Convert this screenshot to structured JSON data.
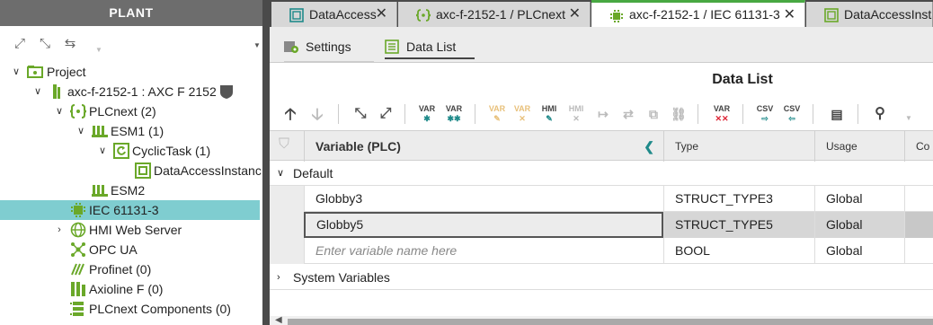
{
  "plant": {
    "title": "PLANT",
    "tree": [
      {
        "label": "Project"
      },
      {
        "label": "axc-f-2152-1 : AXC F 2152"
      },
      {
        "label": "PLCnext (2)"
      },
      {
        "label": "ESM1 (1)"
      },
      {
        "label": "CyclicTask (1)"
      },
      {
        "label": "DataAccessInstanc"
      },
      {
        "label": "ESM2"
      },
      {
        "label": "IEC 61131-3"
      },
      {
        "label": "HMI Web Server"
      },
      {
        "label": "OPC UA"
      },
      {
        "label": "Profinet (0)"
      },
      {
        "label": "Axioline F (0)"
      },
      {
        "label": "PLCnext Components (0)"
      }
    ]
  },
  "tabs": [
    {
      "label": "DataAccess"
    },
    {
      "label": "axc-f-2152-1 / PLCnext"
    },
    {
      "label": "axc-f-2152-1 / IEC 61131-3"
    },
    {
      "label": "DataAccessInsta"
    }
  ],
  "subtabs": [
    {
      "label": "Settings"
    },
    {
      "label": "Data List"
    }
  ],
  "datalist": {
    "title": "Data List",
    "toolbar": {
      "var_label": "VAR",
      "hmi_label": "HMI",
      "csv_label": "CSV"
    },
    "columns": [
      "Variable (PLC)",
      "Type",
      "Usage",
      "Co"
    ],
    "groups": [
      {
        "label": "Default"
      },
      {
        "label": "System Variables"
      }
    ],
    "rows": [
      {
        "variable": "Globby3",
        "type": "STRUCT_TYPE3",
        "usage": "Global"
      },
      {
        "variable": "Globby5",
        "type": "STRUCT_TYPE5",
        "usage": "Global"
      },
      {
        "variable": "",
        "placeholder": "Enter variable name here",
        "type": "BOOL",
        "usage": "Global"
      }
    ]
  },
  "colors": {
    "header_bg": "#6d6d6d",
    "tab_accent": "#48a842",
    "selected_tree": "#7fcdd0",
    "icon_green": "#6aa829",
    "icon_teal": "#1f8a8a"
  }
}
